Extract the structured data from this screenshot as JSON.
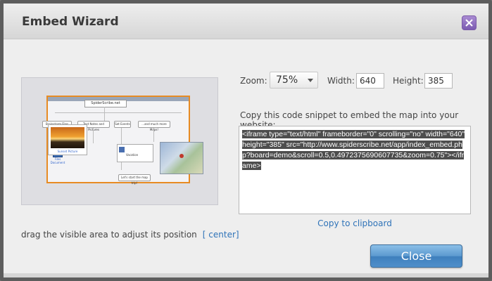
{
  "dialog": {
    "title": "Embed Wizard"
  },
  "preview": {
    "map_title": "SpiderScribe.net",
    "nodes": [
      "Brainstorm Files",
      "Text Notes and Pictures",
      "Set Events",
      "...and much more Maps!"
    ],
    "photo_caption": "Sunset Picture",
    "card_title": "Vacation",
    "doc_caption": "Files Document",
    "footer_label": "Let's start the map trip!",
    "drag_text": "drag the visible area to adjust its position",
    "center_link": "[ center]"
  },
  "controls": {
    "zoom_label": "Zoom:",
    "zoom_value": "75%",
    "width_label": "Width:",
    "width_value": "640",
    "height_label": "Height:",
    "height_value": "385"
  },
  "snippet": {
    "instruction": "Copy this code snippet to embed the map into your website:",
    "code": "<iframe type=\"text/html\" frameborder=\"0\" scrolling=\"no\" width=\"640\" height=\"385\" src=\"http://www.spiderscribe.net/app/index_embed.php?board=demo&scroll=0.5,0.4972375690607735&zoom=0.75\"></iframe>",
    "copy_link": "Copy to clipboard"
  },
  "buttons": {
    "close_label": "Close"
  },
  "colors": {
    "accent_purple": "#7b5bb1",
    "viewport_orange": "#e78b23",
    "link_blue": "#2f73b8",
    "button_blue": "#4f8fca"
  }
}
